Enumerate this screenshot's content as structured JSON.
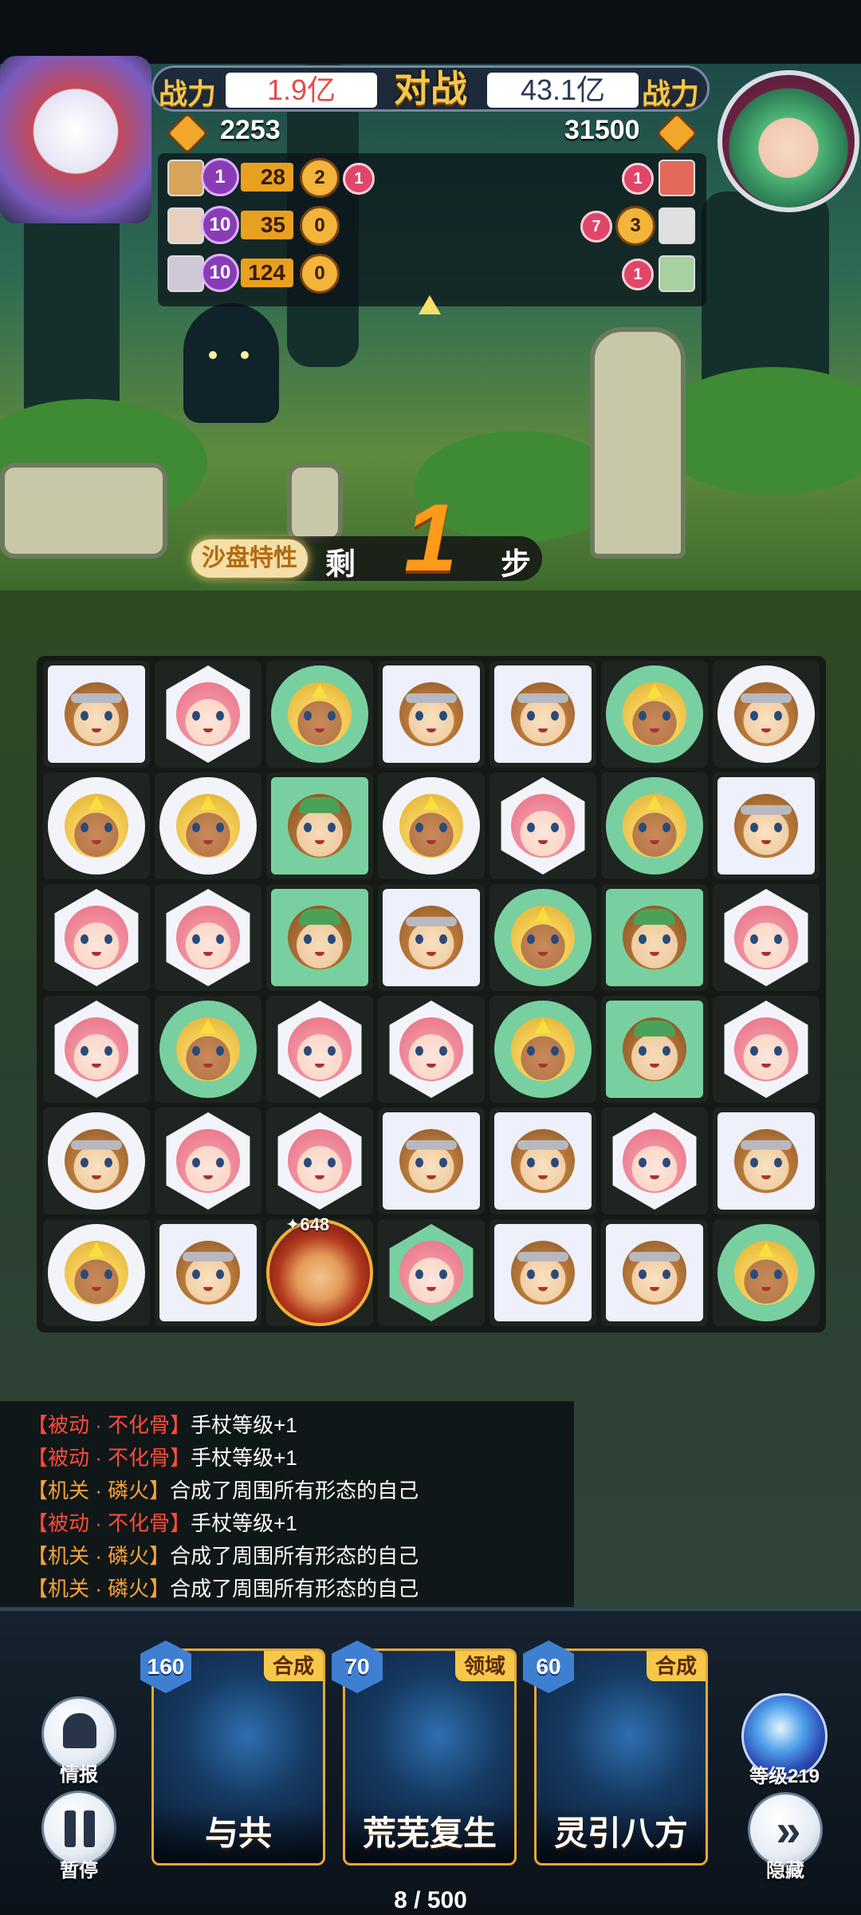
{
  "header": {
    "power_label_left": "战力",
    "power_value_left": "1.9亿",
    "vs_label": "对战",
    "power_value_right": "43.1亿",
    "power_label_right": "战力",
    "score_left": "2253",
    "score_right": "31500"
  },
  "team_panel": {
    "rows": [
      {
        "purple": "1",
        "bar_value": "28",
        "gold": "2",
        "red": "1"
      },
      {
        "purple": "10",
        "bar_value": "35",
        "gold": "0"
      },
      {
        "purple": "10",
        "bar_value": "124",
        "gold": "0"
      }
    ],
    "enemy_rows": [
      {
        "red": "1"
      },
      {
        "red": "7",
        "gold": "3"
      },
      {
        "red": "1"
      }
    ]
  },
  "step_banner": {
    "sandbox_label": "沙盘特性",
    "remaining_label": "剩",
    "steps_value": "1",
    "unit_label": "步"
  },
  "special_tile_value": "648",
  "log": [
    {
      "tag": "【被动 · 不化骨】",
      "text": "手杖等级+1",
      "kind": "passive"
    },
    {
      "tag": "【被动 · 不化骨】",
      "text": "手杖等级+1",
      "kind": "passive"
    },
    {
      "tag": "【机关 · 磷火】",
      "text": "合成了周围所有形态的自己",
      "kind": "fire"
    },
    {
      "tag": "【被动 · 不化骨】",
      "text": "手杖等级+1",
      "kind": "passive"
    },
    {
      "tag": "【机关 · 磷火】",
      "text": "合成了周围所有形态的自己",
      "kind": "fire"
    },
    {
      "tag": "【机关 · 磷火】",
      "text": "合成了周围所有形态的自己",
      "kind": "fire"
    }
  ],
  "buttons": {
    "info_label": "情报",
    "pause_label": "暂停",
    "level_label": "等级219",
    "hide_label": "隐藏"
  },
  "cards": [
    {
      "cost": "160",
      "type": "合成",
      "name": "与共"
    },
    {
      "cost": "70",
      "type": "领域",
      "name": "荒芜复生"
    },
    {
      "cost": "60",
      "type": "合成",
      "name": "灵引八方"
    }
  ],
  "progress_text": "8 / 500",
  "colors": {
    "accent_gold": "#f6c64a",
    "tile_green": "#78d0a0",
    "log_red": "#ff4b3a",
    "log_orange": "#f8a23a"
  }
}
